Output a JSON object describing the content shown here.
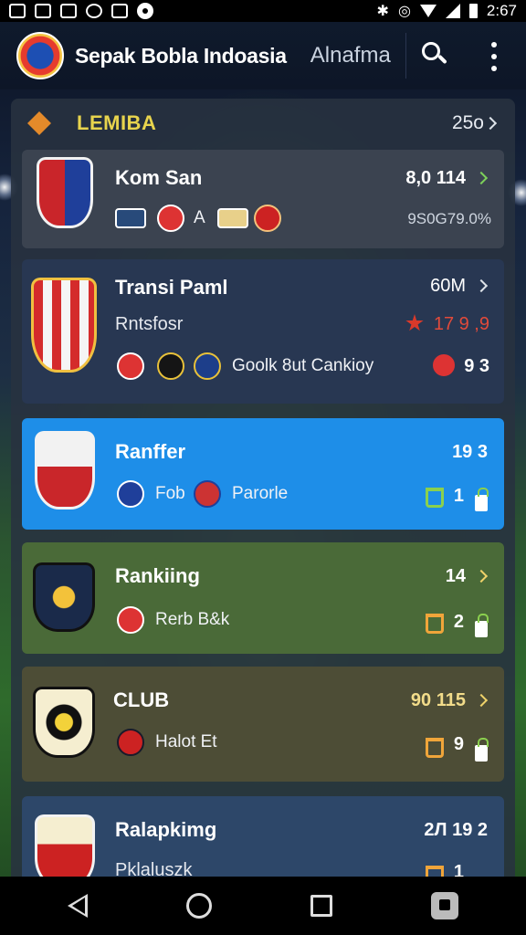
{
  "status_bar": {
    "time": "2:67"
  },
  "app": {
    "title": "Sepak Bobla Indoasia",
    "subtitle": "Alnafma"
  },
  "league": {
    "title": "LEMIBA",
    "count": "25o"
  },
  "cards": [
    {
      "name": "Kom San",
      "score": "8,0 114",
      "detail_a": "A",
      "detail_b": "9S0G79.0%"
    },
    {
      "name": "Transi Paml",
      "score": "60M",
      "sub": "Rntsfosr",
      "stat": "17 9 ,9",
      "detail": "Goolk 8ut Cankioy",
      "stat2": "9 3"
    },
    {
      "name": "Ranffer",
      "score": "19 3",
      "tag_a": "Fob",
      "tag_b": "Parorle",
      "count": "1"
    },
    {
      "name": "Rankiing",
      "score": "14",
      "tag": "Rerb B&k",
      "count": "2"
    },
    {
      "name": "CLUB",
      "score": "90 115",
      "tag": "Halot Et",
      "count": "9"
    },
    {
      "name": "Ralapkimg",
      "score": "2Л 19 2",
      "sub": "Pklaluszk",
      "count": "1"
    }
  ],
  "colors": {
    "accent_blue": "#1e8ee8",
    "league_gold": "#e8d44d",
    "card_green": "#4a6a38",
    "card_olive": "#4d4d36",
    "status_red": "#d9392a",
    "status_green": "#8bd04e"
  }
}
